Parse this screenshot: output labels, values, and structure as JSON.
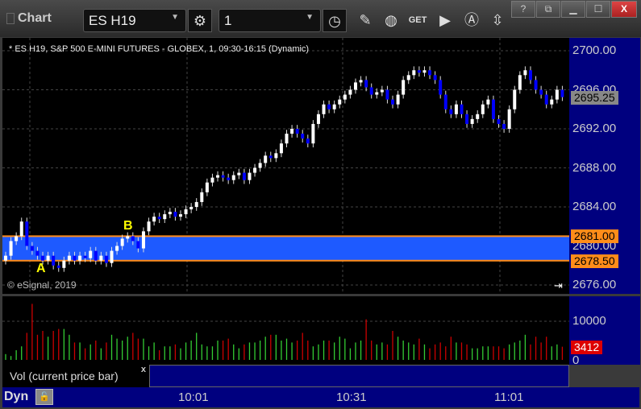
{
  "window": {
    "title": "Chart",
    "symbol": "ES H19",
    "interval": "1",
    "buttons": [
      "?",
      "restore-menu",
      "minimize",
      "maximize",
      "X"
    ]
  },
  "toolbar_icons": [
    "gear-icon",
    "clock-icon",
    "pencil-icon",
    "study-icon",
    "get-icon",
    "play-icon",
    "alert-icon",
    "link-icon"
  ],
  "chart": {
    "header": "* ES H19, S&P 500 E-MINI FUTURES - GLOBEX, 1, 09:30-16:15 (Dynamic)",
    "copyright": "© eSignal, 2019",
    "price_ticks": [
      "2700.00",
      "2696.00",
      "2692.00",
      "2688.00",
      "2684.00",
      "2680.00",
      "2676.00"
    ],
    "current_price": "2695.25",
    "band": {
      "upper": "2681.00",
      "lower": "2678.50",
      "upper_value": 2681.0,
      "lower_value": 2678.5,
      "fill": "#1e5aff",
      "line": "#ff8c1a"
    },
    "markers": {
      "a": "A",
      "b": "B"
    },
    "colors": {
      "up": "#ffffff",
      "down": "#0000ff",
      "vol_up": "#33cc33",
      "vol_down": "#cc0000"
    }
  },
  "chart_data": {
    "type": "candlestick",
    "ylim": [
      2675,
      2701.5
    ],
    "opens": [
      2678.5,
      2679,
      2680.5,
      2681,
      2682.5,
      2680,
      2679.5,
      2679,
      2678.5,
      2679,
      2678,
      2677.75,
      2678.5,
      2679,
      2678.5,
      2679,
      2678.75,
      2679.5,
      2678.5,
      2679,
      2678.25,
      2679.5,
      2680,
      2680.75,
      2681,
      2680.5,
      2679.75,
      2681.5,
      2682.5,
      2683,
      2682.75,
      2683.25,
      2683.5,
      2683,
      2683.25,
      2683.75,
      2684,
      2684.5,
      2685.5,
      2686.5,
      2687,
      2687.25,
      2687,
      2686.75,
      2687.25,
      2687.5,
      2686.75,
      2687.5,
      2688,
      2688.5,
      2689.25,
      2689,
      2689.5,
      2690.5,
      2691.5,
      2692,
      2691.5,
      2691,
      2690.5,
      2692.5,
      2693.5,
      2694.5,
      2694,
      2694.5,
      2695,
      2695.5,
      2696,
      2696.75,
      2697,
      2696.25,
      2695.5,
      2695.75,
      2696,
      2695,
      2694.5,
      2695.5,
      2697,
      2697.5,
      2698,
      2697.75,
      2698,
      2697.5,
      2697,
      2695.5,
      2694,
      2693.5,
      2694.5,
      2693.5,
      2692.5,
      2693,
      2693.5,
      2694.5,
      2695,
      2693,
      2692.5,
      2692,
      2694,
      2696,
      2697.5,
      2698,
      2697,
      2696,
      2695.5,
      2694.5,
      2695,
      2696
    ],
    "closes": [
      2679,
      2680.5,
      2681,
      2682.5,
      2680,
      2679.5,
      2679,
      2678.5,
      2679,
      2678,
      2677.75,
      2678.5,
      2679,
      2678.5,
      2679,
      2678.75,
      2679.5,
      2678.5,
      2679,
      2678.25,
      2679.5,
      2680,
      2680.75,
      2681,
      2680.5,
      2679.75,
      2681.5,
      2682.5,
      2683,
      2682.75,
      2683.25,
      2683.5,
      2683,
      2683.25,
      2683.75,
      2684,
      2684.5,
      2685.5,
      2686.5,
      2687,
      2687.25,
      2687,
      2686.75,
      2687.25,
      2687.5,
      2686.75,
      2687.5,
      2688,
      2688.5,
      2689.25,
      2689,
      2689.5,
      2690.5,
      2691.5,
      2692,
      2691.5,
      2691,
      2690.5,
      2692.5,
      2693.5,
      2694.5,
      2694,
      2694.5,
      2695,
      2695.5,
      2696,
      2696.75,
      2697,
      2696.25,
      2695.5,
      2695.75,
      2696,
      2695,
      2694.5,
      2695.5,
      2697,
      2697.5,
      2698,
      2697.75,
      2698,
      2697.5,
      2697,
      2695.5,
      2694,
      2693.5,
      2694.5,
      2693.5,
      2692.5,
      2693,
      2693.5,
      2694.5,
      2695,
      2693,
      2692.5,
      2692,
      2694,
      2696,
      2697.5,
      2698,
      2697,
      2696,
      2695.5,
      2694.5,
      2695,
      2696,
      2695.25
    ],
    "volume": [
      1500,
      1000,
      2500,
      3500,
      7000,
      14500,
      6500,
      7500,
      6000,
      7500,
      8000,
      8000,
      6500,
      4500,
      4500,
      3000,
      4000,
      5000,
      3000,
      4500,
      6500,
      5500,
      5000,
      6000,
      7000,
      5500,
      5500,
      3500,
      4500,
      2500,
      3500,
      3500,
      4000,
      3000,
      4500,
      5000,
      7000,
      4000,
      3500,
      3500,
      5000,
      5000,
      5500,
      4000,
      3000,
      4000,
      4500,
      4500,
      5000,
      6000,
      6500,
      6500,
      5000,
      5500,
      4500,
      5000,
      7000,
      5000,
      3500,
      4000,
      5000,
      5000,
      4500,
      6000,
      5500,
      3000,
      4500,
      5000,
      10500,
      5000,
      4000,
      4500,
      4000,
      7500,
      6000,
      5000,
      4500,
      4000,
      5500,
      4000,
      3000,
      4000,
      4500,
      3500,
      6000,
      4500,
      4500,
      4000,
      3000,
      3000,
      3500,
      3500,
      3500,
      3500,
      3000,
      4000,
      4500,
      5000,
      6500,
      4000,
      6000,
      4500,
      6000,
      3500,
      4000,
      3412
    ],
    "volume_ticks": [
      "10000",
      "0"
    ],
    "volume_ylim": [
      0,
      17500
    ],
    "current_volume": "3412",
    "x_ticks": [
      "10:01",
      "10:31",
      "11:01"
    ]
  },
  "volume_panel": {
    "legend": "Vol (current price bar)",
    "close": "x"
  },
  "bottom": {
    "dyn": "Dyn"
  }
}
